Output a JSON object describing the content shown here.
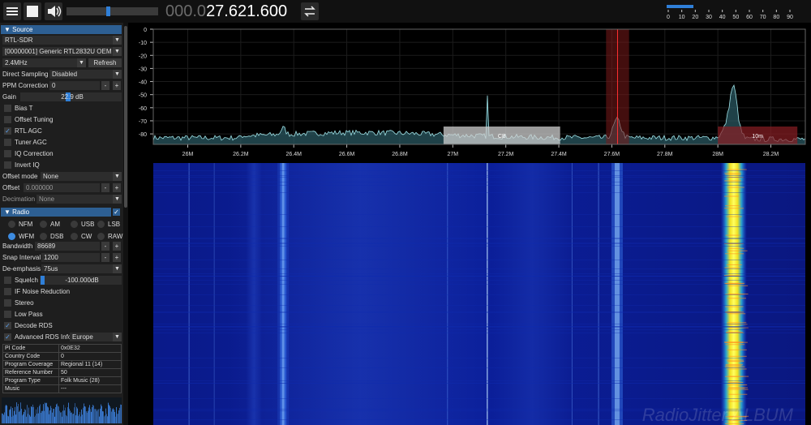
{
  "toolbar": {
    "menu_icon": "menu-icon",
    "stop_icon": "stop-icon",
    "volume_icon": "speaker-icon",
    "volume_level": 0.45,
    "freq_dim": "000.0",
    "freq_lit": "27.621.600",
    "swap_icon": "swap-icon"
  },
  "snr_meter": {
    "ticks": [
      "0",
      "10",
      "20",
      "30",
      "40",
      "50",
      "60",
      "70",
      "80",
      "90"
    ],
    "level": 20
  },
  "source": {
    "header": "Source",
    "device_type": "RTL-SDR",
    "device": "[00000001] Generic RTL2832U OEM",
    "sample_rate": "2.4MHz",
    "refresh_label": "Refresh",
    "direct_sampling_label": "Direct Sampling",
    "direct_sampling_value": "Disabled",
    "ppm_label": "PPM Correction",
    "ppm_value": "0",
    "gain_label": "Gain",
    "gain_value": "22.9 dB",
    "checkboxes": [
      {
        "label": "Bias T",
        "checked": false
      },
      {
        "label": "Offset Tuning",
        "checked": false
      },
      {
        "label": "RTL AGC",
        "checked": true
      },
      {
        "label": "Tuner AGC",
        "checked": false
      },
      {
        "label": "IQ Correction",
        "checked": false
      },
      {
        "label": "Invert IQ",
        "checked": false
      }
    ],
    "offset_mode_label": "Offset mode",
    "offset_mode_value": "None",
    "offset_label": "Offset",
    "offset_value": "0.000000",
    "decimation_label": "Decimation",
    "decimation_value": "None"
  },
  "radio": {
    "header": "Radio",
    "modes": [
      "NFM",
      "AM",
      "USB",
      "LSB",
      "WFM",
      "DSB",
      "CW",
      "RAW"
    ],
    "selected_mode": "WFM",
    "bandwidth_label": "Bandwidth",
    "bandwidth_value": "86689",
    "snap_label": "Snap Interval",
    "snap_value": "1200",
    "deemph_label": "De-emphasis",
    "deemph_value": "75us",
    "squelch_label": "Squelch",
    "squelch_value": "-100.000dB",
    "checkboxes": [
      {
        "label": "IF Noise Reduction",
        "checked": false
      },
      {
        "label": "Stereo",
        "checked": false
      },
      {
        "label": "Low Pass",
        "checked": false
      },
      {
        "label": "Decode RDS",
        "checked": true
      }
    ],
    "advanced_rds_label": "Advanced RDS Info",
    "advanced_rds_checked": true,
    "region": "Europe",
    "rds_table": [
      {
        "key": "PI Code",
        "value": "0x0E32"
      },
      {
        "key": "Country Code",
        "value": "0"
      },
      {
        "key": "Program Coverage",
        "value": "Regional 11 (14)"
      },
      {
        "key": "Reference Number",
        "value": "50"
      },
      {
        "key": "Program Type",
        "value": "Folk Music (28)"
      },
      {
        "key": "Music",
        "value": "---"
      }
    ]
  },
  "spectrum": {
    "y_ticks": [
      "0",
      "-10",
      "-20",
      "-30",
      "-40",
      "-50",
      "-60",
      "-70",
      "-80"
    ],
    "x_ticks": [
      "26M",
      "26.2M",
      "26.4M",
      "26.6M",
      "26.8M",
      "27M",
      "27.2M",
      "27.4M",
      "27.6M",
      "27.8M",
      "28M",
      "28.2M"
    ],
    "bands": [
      {
        "label": "CB",
        "start": 26.965,
        "end": 27.405
      },
      {
        "label": "10m",
        "start": 28.0,
        "end": 28.3
      }
    ],
    "vfo_mhz": 27.6216,
    "vfo_bandwidth_khz": 86.689,
    "colors": {
      "trace": "#9fe3e8",
      "fill": "#2c5d67",
      "band_cb": "#cfcfcf",
      "band_10m": "#8a1e24",
      "vfo": "#7a1a1a"
    }
  },
  "watermark": "RadioJitter ALBUM"
}
